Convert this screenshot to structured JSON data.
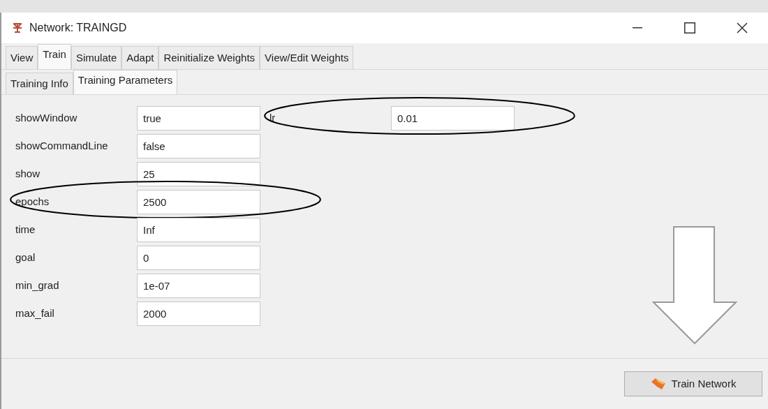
{
  "window": {
    "title": "Network: TRAINGD"
  },
  "tabs": [
    {
      "label": "View",
      "selected": false
    },
    {
      "label": "Train",
      "selected": true
    },
    {
      "label": "Simulate",
      "selected": false
    },
    {
      "label": "Adapt",
      "selected": false
    },
    {
      "label": "Reinitialize Weights",
      "selected": false
    },
    {
      "label": "View/Edit Weights",
      "selected": false
    }
  ],
  "subtabs": [
    {
      "label": "Training Info",
      "selected": false
    },
    {
      "label": "Training Parameters",
      "selected": true
    }
  ],
  "parameters_left": [
    {
      "name": "showWindow",
      "value": "true",
      "circled": false
    },
    {
      "name": "showCommandLine",
      "value": "false",
      "circled": false
    },
    {
      "name": "show",
      "value": "25",
      "circled": false
    },
    {
      "name": "epochs",
      "value": "2500",
      "circled": true
    },
    {
      "name": "time",
      "value": "Inf",
      "circled": false
    },
    {
      "name": "goal",
      "value": "0",
      "circled": false
    },
    {
      "name": "min_grad",
      "value": "1e-07",
      "circled": false
    },
    {
      "name": "max_fail",
      "value": "2000",
      "circled": false
    }
  ],
  "parameters_right": [
    {
      "name": "lr",
      "value": "0.01",
      "circled": true
    }
  ],
  "train_button": {
    "label": "Train Network",
    "pointed_at": true
  }
}
